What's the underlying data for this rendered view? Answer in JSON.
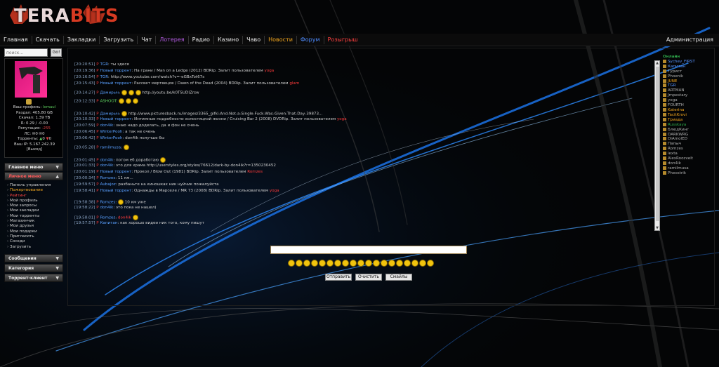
{
  "logo": {
    "text_a": "TERA",
    "text_b": "BITS"
  },
  "nav": {
    "items": [
      {
        "label": "Главная",
        "color": "#e8e8e8"
      },
      {
        "label": "Скачать",
        "color": "#e8e8e8"
      },
      {
        "label": "Закладки",
        "color": "#e8e8e8"
      },
      {
        "label": "Загрузить",
        "color": "#e8e8e8"
      },
      {
        "label": "Чат",
        "color": "#e8e8e8"
      },
      {
        "label": "Лотерея",
        "color": "#b15be0"
      },
      {
        "label": "Радио",
        "color": "#e8e8e8"
      },
      {
        "label": "Казино",
        "color": "#e8e8e8"
      },
      {
        "label": "Чаво",
        "color": "#e8e8e8"
      },
      {
        "label": "Новости",
        "color": "#f2a61e"
      },
      {
        "label": "Форум",
        "color": "#4f8cff"
      },
      {
        "label": "Розыгрыш",
        "color": "#ff4040"
      }
    ],
    "admin": "Администрация"
  },
  "search": {
    "placeholder": "поиск...",
    "button": "Go!"
  },
  "profile": {
    "line1": "Ваш профиль:",
    "nick": "Ixmaul",
    "ratio_up": "Раздал: 405.80 GB",
    "ratio_down": "Скачал: 1.39 TB",
    "ratio": "R: 0.29 / -0.00",
    "reputation_label": "Репутация:",
    "reputation": "-255",
    "ls": "ЛС:",
    "ls_count_in": "0",
    "ls_count_out": "0",
    "torrents": "Торренты:",
    "torrents_up": "0",
    "torrents_down": "0",
    "ip": "Ваш IP: 5.167.242.39",
    "logout": "[Выход]"
  },
  "menus": {
    "main": "Главное меню",
    "personal": "Личное меню",
    "messages": "Сообщения",
    "category": "Категория",
    "torrent_client": "Торрент-клиент"
  },
  "submenu": [
    {
      "label": "Панель управления",
      "cls": ""
    },
    {
      "label": "Пожертвование",
      "cls": "orange"
    },
    {
      "label": "Рейтинг",
      "cls": "red"
    },
    {
      "label": "Мой профиль",
      "cls": ""
    },
    {
      "label": "Мои запросы",
      "cls": ""
    },
    {
      "label": "Мои закладки",
      "cls": ""
    },
    {
      "label": "Мои торренты",
      "cls": ""
    },
    {
      "label": "Магазинчик",
      "cls": ""
    },
    {
      "label": "Мои друзья",
      "cls": ""
    },
    {
      "label": "Мои подарки",
      "cls": ""
    },
    {
      "label": "Пригласить",
      "cls": ""
    },
    {
      "label": "Соседи",
      "cls": ""
    },
    {
      "label": "Загрузить",
      "cls": ""
    }
  ],
  "chat": [
    {
      "time": "[20:20:51]",
      "user": "TGR",
      "text": "ты здеся"
    },
    {
      "time": "[20:19:36]",
      "user": "Новый торрент",
      "text": "На грани / Man on a Ledge (2012) BDRip. Залит пользователем",
      "extra": "yoga"
    },
    {
      "time": "[20:16:54]",
      "user": "TGR",
      "text": "http://www.youtube.com/watch?v=-eGBxTot67s"
    },
    {
      "time": "[20:15:43]",
      "user": "Новый торрент",
      "text": "Рассвет мертвецов / Dawn of the Dead (2004) BDRip. Залит пользователем",
      "extra": "glam"
    },
    {
      "time": "[20:14:27]",
      "user": "Дамирыч",
      "text": "http://youtu.be/k0TSUDIZrsw"
    },
    {
      "time": "[20:12:33]",
      "user": "ASHOOT:",
      "text": ""
    },
    {
      "time": "[20:10:42]",
      "user": "Дамирыч",
      "text": "http://www.picturesback.ru/images/3365_gifki-And-Not-a-Single-Fuck-Was-Given-That-Day-39873..."
    },
    {
      "time": "[20:10:33]",
      "user": "Новый торрент",
      "text": "Интимные подробности холостяцкой жизни / Cruising Bar 2 (2008) DVDRip. Залит пользователем",
      "extra": "yoga"
    },
    {
      "time": "[20:07:59]",
      "user": "don4ik",
      "text": "знаю надо доделать, да и фон не очень"
    },
    {
      "time": "[20:06:45]",
      "user": "WinterPooh",
      "text": "а так не очень"
    },
    {
      "time": "[20:06:42]",
      "user": "WinterPooh",
      "text": "don4ik  получше бы"
    },
    {
      "time": "[20:05:28]",
      "user": "ramilmusa",
      "text": ""
    },
    {
      "time": "[20:01:45]",
      "user": "don4ik",
      "text": "потом еб доработаю"
    },
    {
      "time": "[20:01:33]",
      "user": "don4ik",
      "text": "это для храма http://userstyles.org/styles/76612/dark-by-don4ik?r=1350230452"
    },
    {
      "time": "[20:01:19]",
      "user": "Новый торрент",
      "text": "Прокол / Blow Out (1981) BDRip. Залит пользователем",
      "extra": "Romzes"
    },
    {
      "time": "[20:00:34]",
      "user": "Romzes",
      "text": "11 км..."
    },
    {
      "time": "[19:59:57]",
      "user": "Aubajoz",
      "text": "разбаньте на киношках ник нуйчик пожалуйста"
    },
    {
      "time": "[19:58:41]",
      "user": "Новый торрент",
      "text": "Однажды в Марселе / MR 73 (2008) BDRip. Залит пользователем",
      "extra": "yoga"
    },
    {
      "time": "[19:58:38]",
      "user": "Romzes",
      "text": "10 км уже"
    },
    {
      "time": "[19:58:22]",
      "user": "don4ik",
      "text": "это пока не нашел)"
    },
    {
      "time": "[19:58:01]",
      "user": "Romzes",
      "text": "don4ik"
    },
    {
      "time": "[19:57:57]",
      "user": "Капитан",
      "text": "как хорошо видеи ник того, кому пишут"
    }
  ],
  "online_title": "Онлайн",
  "users": [
    {
      "name": "Sychev_FIRST",
      "color": "#5a96ff"
    },
    {
      "name": "Капитан",
      "color": "#5a96ff"
    },
    {
      "name": "Турист",
      "color": "#b0b0b0"
    },
    {
      "name": "Phoenik",
      "color": "#b0b0b0"
    },
    {
      "name": "JUNE",
      "color": "#f2a61e"
    },
    {
      "name": "TGR",
      "color": "#5a96ff"
    },
    {
      "name": "ARTMAN",
      "color": "#b0b0b0"
    },
    {
      "name": "Jmpestary",
      "color": "#b0b0b0"
    },
    {
      "name": "yoga",
      "color": "#b0b0b0"
    },
    {
      "name": "FOURTH",
      "color": "#b0b0b0"
    },
    {
      "name": "Katerina",
      "color": "#f2a61e"
    },
    {
      "name": "TacitKrovi",
      "color": "#f2a61e"
    },
    {
      "name": "Триада",
      "color": "#f2a61e"
    },
    {
      "name": "Russkaya",
      "color": "#2ea84a"
    },
    {
      "name": "БлюдКинг",
      "color": "#b0b0b0"
    },
    {
      "name": "DARKWRG",
      "color": "#b0b0b0"
    },
    {
      "name": "DiAmolED",
      "color": "#b0b0b0"
    },
    {
      "name": "Папыч",
      "color": "#b0b0b0"
    },
    {
      "name": "Romzes",
      "color": "#b0b0b0"
    },
    {
      "name": "lexta",
      "color": "#b0b0b0"
    },
    {
      "name": "AlexRoozvelt",
      "color": "#b0b0b0"
    },
    {
      "name": "don4ik",
      "color": "#b0b0b0"
    },
    {
      "name": "ramilmusa",
      "color": "#b0b0b0"
    },
    {
      "name": "Pheostrik",
      "color": "#b0b0b0"
    }
  ],
  "buttons": {
    "send": "Отправить",
    "clear": "Очистить",
    "smiles": "Смайлы"
  }
}
